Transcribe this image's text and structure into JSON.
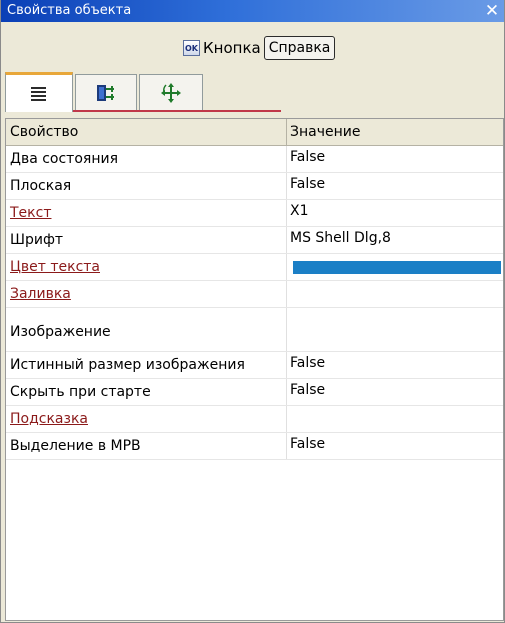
{
  "window": {
    "title": "Свойства объекта",
    "close_glyph": "✕"
  },
  "toolbar": {
    "ok_label": "OK",
    "button_caption": "Кнопка",
    "help_label": "Справка"
  },
  "tabs": [
    {
      "icon": "property-list-icon",
      "active": true
    },
    {
      "icon": "events-icon",
      "active": false
    },
    {
      "icon": "move-arrows-icon",
      "active": false
    }
  ],
  "grid": {
    "header_property": "Свойство",
    "header_value": "Значение",
    "rows": [
      {
        "name": "Два состояния",
        "value": "False",
        "link": false
      },
      {
        "name": "Плоская",
        "value": "False",
        "link": false
      },
      {
        "name": "Текст",
        "value": "X1",
        "link": true
      },
      {
        "name": "Шрифт",
        "value": "MS Shell Dlg,8",
        "link": false
      },
      {
        "name": "Цвет текста",
        "value": "",
        "link": true,
        "color": "#1b7fc6"
      },
      {
        "name": "Заливка",
        "value": "",
        "link": true
      },
      {
        "name": "Изображение",
        "value": "",
        "link": false
      },
      {
        "name": "Истинный размер изображения",
        "value": "False",
        "link": false
      },
      {
        "name": "Скрыть при старте",
        "value": "False",
        "link": false
      },
      {
        "name": "Подсказка",
        "value": "",
        "link": true
      },
      {
        "name": "Выделение в МРВ",
        "value": "False",
        "link": false
      }
    ]
  }
}
